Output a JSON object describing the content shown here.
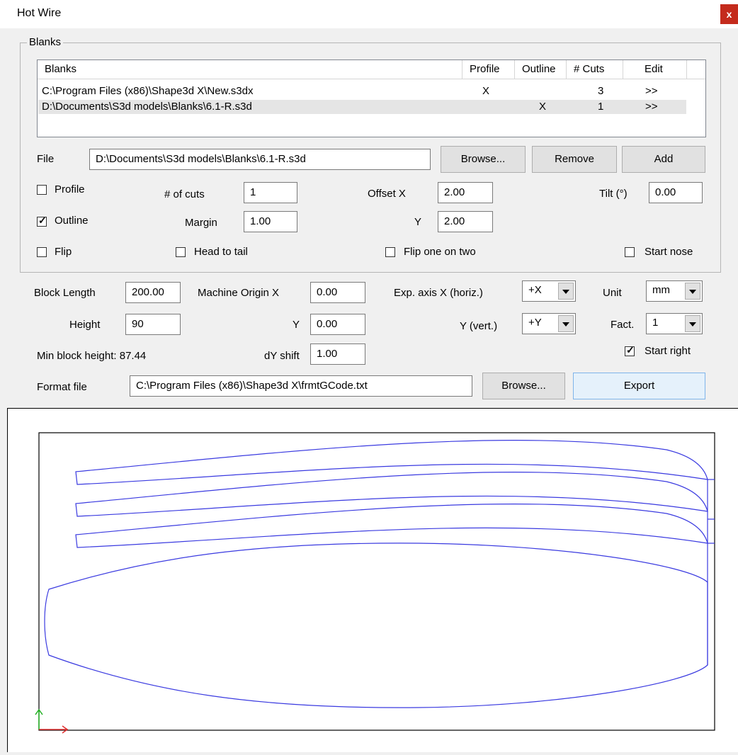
{
  "window": {
    "title": "Hot Wire",
    "close_label": "x"
  },
  "blanks_group": {
    "legend": "Blanks",
    "columns": [
      "Blanks",
      "Profile",
      "Outline",
      "# Cuts",
      "Edit"
    ],
    "rows": [
      {
        "path": "C:\\Program Files (x86)\\Shape3d X\\New.s3dx",
        "profile": "X",
        "outline": "",
        "cuts": "3",
        "edit": ">>"
      },
      {
        "path": "D:\\Documents\\S3d models\\Blanks\\6.1-R.s3d",
        "profile": "",
        "outline": "X",
        "cuts": "1",
        "edit": ">>"
      }
    ],
    "file_label": "File",
    "file_value": "D:\\Documents\\S3d models\\Blanks\\6.1-R.s3d",
    "browse_label": "Browse...",
    "remove_label": "Remove",
    "add_label": "Add",
    "profile_label": "Profile",
    "outline_label": "Outline",
    "flip_label": "Flip",
    "cuts_label": "# of cuts",
    "cuts_value": "1",
    "margin_label": "Margin",
    "margin_value": "1.00",
    "head_to_tail_label": "Head to tail",
    "offset_x_label": "Offset  X",
    "offset_x_value": "2.00",
    "offset_y_label": "Y",
    "offset_y_value": "2.00",
    "flip_one_label": "Flip one on two",
    "tilt_label": "Tilt (°)",
    "tilt_value": "0.00",
    "start_nose_label": "Start nose",
    "profile_checked": false,
    "outline_checked": true,
    "flip_checked": false,
    "head_to_tail_checked": false,
    "flip_one_checked": false,
    "start_nose_checked": false
  },
  "export": {
    "block_length_label": "Block  Length",
    "block_length_value": "200.00",
    "height_label": "Height",
    "height_value": "90",
    "min_height_text": "Min block height: 87.44",
    "machine_origin_x_label": "Machine Origin  X",
    "machine_origin_x_value": "0.00",
    "machine_origin_y_label": "Y",
    "machine_origin_y_value": "0.00",
    "dy_shift_label": "dY shift",
    "dy_shift_value": "1.00",
    "exp_axis_x_label": "Exp. axis  X (horiz.)",
    "exp_axis_x_value": "+X",
    "exp_axis_y_label": "Y (vert.)",
    "exp_axis_y_value": "+Y",
    "unit_label": "Unit",
    "unit_value": "mm",
    "fact_label": "Fact.",
    "fact_value": "1",
    "start_right_label": "Start right",
    "start_right_checked": true,
    "format_file_label": "Format file",
    "format_file_value": "C:\\Program Files (x86)\\Shape3d X\\frmtGCode.txt",
    "browse_label": "Browse...",
    "export_label": "Export"
  },
  "preview": {
    "outline_color": "#3a3ae0",
    "axis_x_color": "#e03030",
    "axis_y_color": "#20b020",
    "frame_color": "#000000"
  }
}
